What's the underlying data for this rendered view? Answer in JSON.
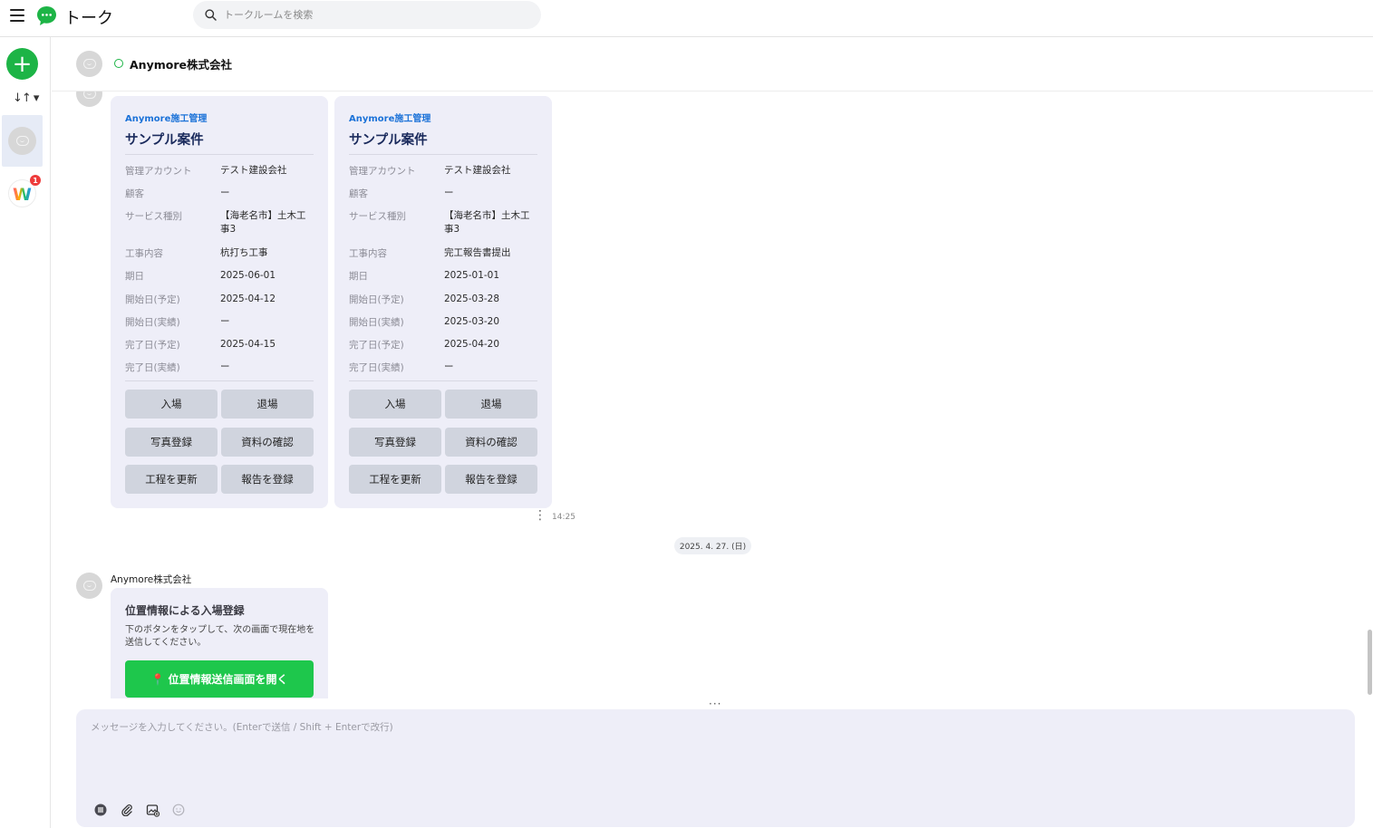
{
  "app": {
    "title": "トーク",
    "search_placeholder": "トークルームを検索"
  },
  "rail": {
    "sort_label": "↓↑ ▾",
    "badge_count": "1",
    "w_logo_letter": "W"
  },
  "chat": {
    "room_name": "Anymore株式会社"
  },
  "cards": [
    {
      "brand": "Anymore施工管理",
      "project": "サンプル案件",
      "rows": [
        {
          "k": "管理アカウント",
          "v": "テスト建設会社"
        },
        {
          "k": "顧客",
          "v": "ー"
        },
        {
          "k": "サービス種別",
          "v": "【海老名市】土木工事3"
        },
        {
          "k": "工事内容",
          "v": "杭打ち工事"
        },
        {
          "k": "期日",
          "v": "2025-06-01"
        },
        {
          "k": "開始日(予定)",
          "v": "2025-04-12"
        },
        {
          "k": "開始日(実績)",
          "v": "ー"
        },
        {
          "k": "完了日(予定)",
          "v": "2025-04-15"
        },
        {
          "k": "完了日(実績)",
          "v": "ー"
        }
      ],
      "buttons": [
        "入場",
        "退場",
        "写真登録",
        "資料の確認",
        "工程を更新",
        "報告を登録"
      ]
    },
    {
      "brand": "Anymore施工管理",
      "project": "サンプル案件",
      "rows": [
        {
          "k": "管理アカウント",
          "v": "テスト建設会社"
        },
        {
          "k": "顧客",
          "v": "ー"
        },
        {
          "k": "サービス種別",
          "v": "【海老名市】土木工事3"
        },
        {
          "k": "工事内容",
          "v": "完工報告書提出"
        },
        {
          "k": "期日",
          "v": "2025-01-01"
        },
        {
          "k": "開始日(予定)",
          "v": "2025-03-28"
        },
        {
          "k": "開始日(実績)",
          "v": "2025-03-20"
        },
        {
          "k": "完了日(予定)",
          "v": "2025-04-20"
        },
        {
          "k": "完了日(実績)",
          "v": "ー"
        }
      ],
      "buttons": [
        "入場",
        "退場",
        "写真登録",
        "資料の確認",
        "工程を更新",
        "報告を登録"
      ]
    }
  ],
  "message_meta": {
    "dots": "⋮",
    "time": "14:25"
  },
  "date_separator": "2025. 4. 27. (日)",
  "location_message": {
    "sender": "Anymore株式会社",
    "title": "位置情報による入場登録",
    "description": "下のボタンをタップして、次の画面で現在地を送信してください。",
    "button_label": "📍 位置情報送信画面を開く"
  },
  "composer": {
    "grip": "···",
    "placeholder": "メッセージを入力してください。(Enterで送信 / Shift + Enterで改行)"
  },
  "colors": {
    "accent_green": "#1db446",
    "brand_blue": "#1b72d8",
    "card_bg": "#eeeef8",
    "button_bg": "#d0d4de",
    "badge_red": "#ee3b3b"
  }
}
